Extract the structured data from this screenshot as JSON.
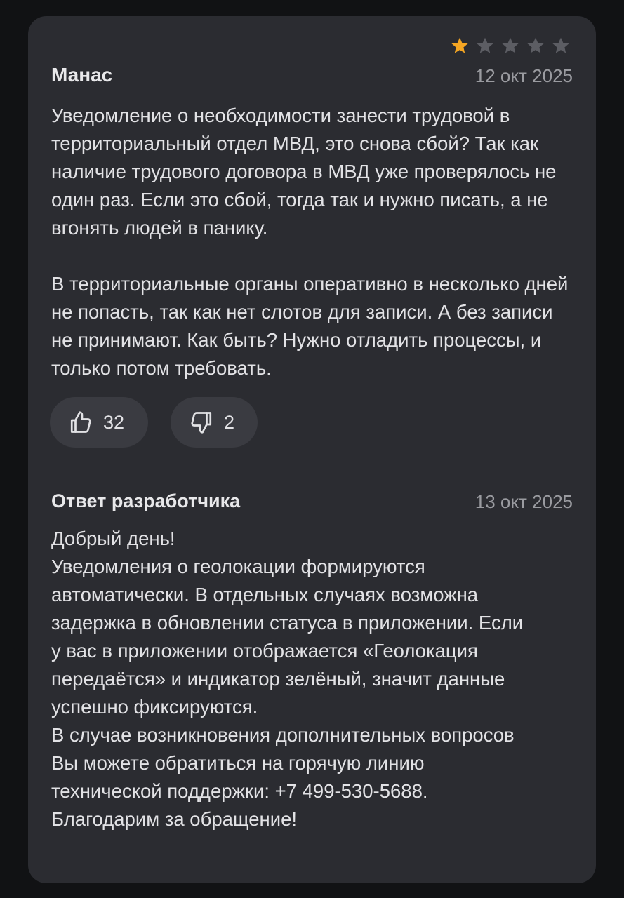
{
  "review": {
    "author": "Манас",
    "date": "12 окт 2025",
    "rating": 1,
    "rating_max": 5,
    "paragraphs": [
      "Уведомление о необходимости занести трудовой в территориальный отдел МВД, это снова сбой? Так как наличие трудового договора в МВД уже проверялось не один раз. Если это сбой, тогда так и нужно писать, а не вгонять людей в панику.",
      "В территориальные органы оперативно в несколько дней не попасть, так как нет слотов для записи. А без записи не принимают. Как быть? Нужно отладить процессы, и только потом требовать."
    ],
    "likes": "32",
    "dislikes": "2"
  },
  "reply": {
    "title": "Ответ разработчика",
    "date": "13 окт 2025",
    "lines": [
      "Добрый день!",
      "Уведомления о геолокации формируются",
      "автоматически. В отдельных случаях возможна",
      "задержка в обновлении статуса в приложении. Если",
      "у вас в приложении отображается «Геолокация",
      "передаётся» и индикатор зелёный, значит данные",
      "успешно фиксируются.",
      "В случае возникновения дополнительных вопросов",
      "Вы можете обратиться на горячую линию",
      "технической поддержки: +7 499-530-5688.",
      "Благодарим за обращение!"
    ]
  },
  "colors": {
    "star_filled": "#f5a623",
    "star_empty": "#5c5d63",
    "card_bg": "#2b2c31",
    "page_bg": "#111214"
  },
  "icons": {
    "like": "thumbs-up-icon",
    "dislike": "thumbs-down-icon",
    "star": "star-icon"
  }
}
